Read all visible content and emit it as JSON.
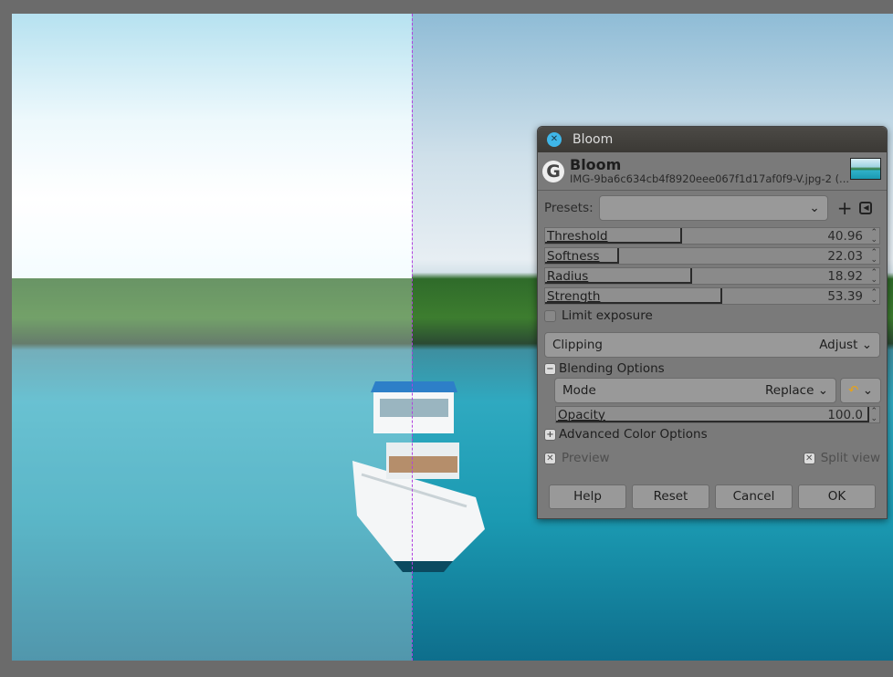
{
  "dialog": {
    "title": "Bloom",
    "filter_name": "Bloom",
    "file_name": "IMG-9ba6c634cb4f8920eee067f1d17af0f9-V.jpg-2 (...",
    "presets_label": "Presets:",
    "presets_value": "",
    "sliders": [
      {
        "label": "Threshold",
        "value": "40.96",
        "fraction": 0.41
      },
      {
        "label": "Softness",
        "value": "22.03",
        "fraction": 0.22
      },
      {
        "label": "Radius",
        "value": "18.92",
        "fraction": 0.44
      },
      {
        "label": "Strength",
        "value": "53.39",
        "fraction": 0.53
      }
    ],
    "limit_exposure": {
      "label": "Limit exposure",
      "checked": false
    },
    "clipping": {
      "label": "Clipping",
      "value": "Adjust"
    },
    "blending": {
      "label": "Blending Options",
      "mode_label": "Mode",
      "mode_value": "Replace",
      "opacity_label": "Opacity",
      "opacity_value": "100.0"
    },
    "advanced": {
      "label": "Advanced Color Options"
    },
    "preview": {
      "label": "Preview",
      "checked": true
    },
    "split_view": {
      "label": "Split view",
      "checked": true
    },
    "buttons": {
      "help": "Help",
      "reset": "Reset",
      "cancel": "Cancel",
      "ok": "OK"
    }
  },
  "colors": {
    "split_line": "#b040e0",
    "close_button": "#3fb6e8"
  }
}
